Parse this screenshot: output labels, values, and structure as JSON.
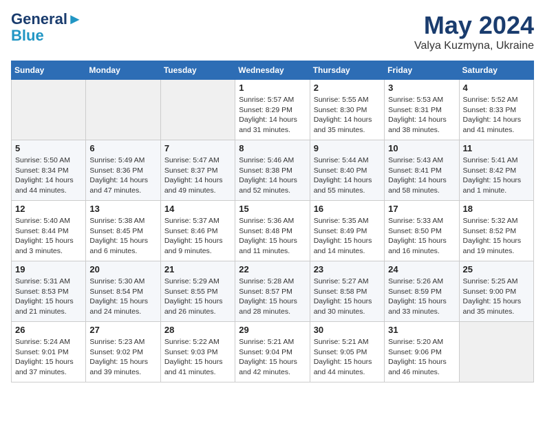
{
  "header": {
    "logo_line1": "General",
    "logo_line2": "Blue",
    "month_title": "May 2024",
    "location": "Valya Kuzmyna, Ukraine"
  },
  "weekdays": [
    "Sunday",
    "Monday",
    "Tuesday",
    "Wednesday",
    "Thursday",
    "Friday",
    "Saturday"
  ],
  "weeks": [
    [
      {
        "day": "",
        "info": ""
      },
      {
        "day": "",
        "info": ""
      },
      {
        "day": "",
        "info": ""
      },
      {
        "day": "1",
        "info": "Sunrise: 5:57 AM\nSunset: 8:29 PM\nDaylight: 14 hours\nand 31 minutes."
      },
      {
        "day": "2",
        "info": "Sunrise: 5:55 AM\nSunset: 8:30 PM\nDaylight: 14 hours\nand 35 minutes."
      },
      {
        "day": "3",
        "info": "Sunrise: 5:53 AM\nSunset: 8:31 PM\nDaylight: 14 hours\nand 38 minutes."
      },
      {
        "day": "4",
        "info": "Sunrise: 5:52 AM\nSunset: 8:33 PM\nDaylight: 14 hours\nand 41 minutes."
      }
    ],
    [
      {
        "day": "5",
        "info": "Sunrise: 5:50 AM\nSunset: 8:34 PM\nDaylight: 14 hours\nand 44 minutes."
      },
      {
        "day": "6",
        "info": "Sunrise: 5:49 AM\nSunset: 8:36 PM\nDaylight: 14 hours\nand 47 minutes."
      },
      {
        "day": "7",
        "info": "Sunrise: 5:47 AM\nSunset: 8:37 PM\nDaylight: 14 hours\nand 49 minutes."
      },
      {
        "day": "8",
        "info": "Sunrise: 5:46 AM\nSunset: 8:38 PM\nDaylight: 14 hours\nand 52 minutes."
      },
      {
        "day": "9",
        "info": "Sunrise: 5:44 AM\nSunset: 8:40 PM\nDaylight: 14 hours\nand 55 minutes."
      },
      {
        "day": "10",
        "info": "Sunrise: 5:43 AM\nSunset: 8:41 PM\nDaylight: 14 hours\nand 58 minutes."
      },
      {
        "day": "11",
        "info": "Sunrise: 5:41 AM\nSunset: 8:42 PM\nDaylight: 15 hours\nand 1 minute."
      }
    ],
    [
      {
        "day": "12",
        "info": "Sunrise: 5:40 AM\nSunset: 8:44 PM\nDaylight: 15 hours\nand 3 minutes."
      },
      {
        "day": "13",
        "info": "Sunrise: 5:38 AM\nSunset: 8:45 PM\nDaylight: 15 hours\nand 6 minutes."
      },
      {
        "day": "14",
        "info": "Sunrise: 5:37 AM\nSunset: 8:46 PM\nDaylight: 15 hours\nand 9 minutes."
      },
      {
        "day": "15",
        "info": "Sunrise: 5:36 AM\nSunset: 8:48 PM\nDaylight: 15 hours\nand 11 minutes."
      },
      {
        "day": "16",
        "info": "Sunrise: 5:35 AM\nSunset: 8:49 PM\nDaylight: 15 hours\nand 14 minutes."
      },
      {
        "day": "17",
        "info": "Sunrise: 5:33 AM\nSunset: 8:50 PM\nDaylight: 15 hours\nand 16 minutes."
      },
      {
        "day": "18",
        "info": "Sunrise: 5:32 AM\nSunset: 8:52 PM\nDaylight: 15 hours\nand 19 minutes."
      }
    ],
    [
      {
        "day": "19",
        "info": "Sunrise: 5:31 AM\nSunset: 8:53 PM\nDaylight: 15 hours\nand 21 minutes."
      },
      {
        "day": "20",
        "info": "Sunrise: 5:30 AM\nSunset: 8:54 PM\nDaylight: 15 hours\nand 24 minutes."
      },
      {
        "day": "21",
        "info": "Sunrise: 5:29 AM\nSunset: 8:55 PM\nDaylight: 15 hours\nand 26 minutes."
      },
      {
        "day": "22",
        "info": "Sunrise: 5:28 AM\nSunset: 8:57 PM\nDaylight: 15 hours\nand 28 minutes."
      },
      {
        "day": "23",
        "info": "Sunrise: 5:27 AM\nSunset: 8:58 PM\nDaylight: 15 hours\nand 30 minutes."
      },
      {
        "day": "24",
        "info": "Sunrise: 5:26 AM\nSunset: 8:59 PM\nDaylight: 15 hours\nand 33 minutes."
      },
      {
        "day": "25",
        "info": "Sunrise: 5:25 AM\nSunset: 9:00 PM\nDaylight: 15 hours\nand 35 minutes."
      }
    ],
    [
      {
        "day": "26",
        "info": "Sunrise: 5:24 AM\nSunset: 9:01 PM\nDaylight: 15 hours\nand 37 minutes."
      },
      {
        "day": "27",
        "info": "Sunrise: 5:23 AM\nSunset: 9:02 PM\nDaylight: 15 hours\nand 39 minutes."
      },
      {
        "day": "28",
        "info": "Sunrise: 5:22 AM\nSunset: 9:03 PM\nDaylight: 15 hours\nand 41 minutes."
      },
      {
        "day": "29",
        "info": "Sunrise: 5:21 AM\nSunset: 9:04 PM\nDaylight: 15 hours\nand 42 minutes."
      },
      {
        "day": "30",
        "info": "Sunrise: 5:21 AM\nSunset: 9:05 PM\nDaylight: 15 hours\nand 44 minutes."
      },
      {
        "day": "31",
        "info": "Sunrise: 5:20 AM\nSunset: 9:06 PM\nDaylight: 15 hours\nand 46 minutes."
      },
      {
        "day": "",
        "info": ""
      }
    ]
  ]
}
